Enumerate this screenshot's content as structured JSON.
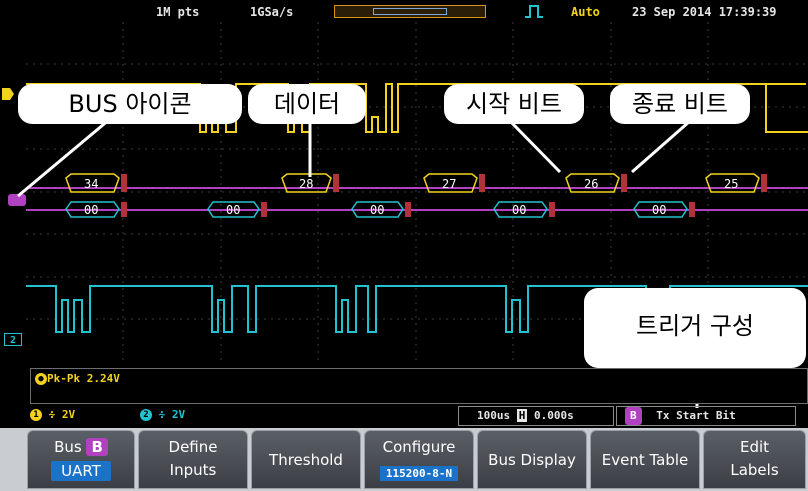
{
  "topbar": {
    "record_length": "1M pts",
    "sample_rate": "1GSa/s",
    "trigger_mode": "Auto",
    "datetime": "23 Sep 2014 17:39:39"
  },
  "callouts": {
    "bus_icon": "BUS 아이콘",
    "data": "데이터",
    "start_bit": "시작 비트",
    "stop_bit": "종료 비트",
    "trigger_config": "트리거 구성"
  },
  "decoded": {
    "top_row": [
      "34",
      "28",
      "27",
      "26",
      "25"
    ],
    "bottom_row": [
      "00",
      "00",
      "00",
      "00",
      "00"
    ]
  },
  "channel_markers": {
    "ch2": "2"
  },
  "measurement": {
    "label": "Pk-Pk 2.24V"
  },
  "status": {
    "ch1_num": "1",
    "ch1_scale": "2V",
    "ch2_num": "2",
    "ch2_scale": "2V",
    "timebase": "100us",
    "delay": "0.000s",
    "bus_badge": "B",
    "trigger_info": "Tx Start Bit"
  },
  "softkeys": {
    "bus_label": "Bus",
    "bus_badge": "B",
    "bus_value": "UART",
    "define_l1": "Define",
    "define_l2": "Inputs",
    "threshold": "Threshold",
    "configure_l1": "Configure",
    "configure_value": "115200-8-N",
    "bus_display": "Bus Display",
    "event_table": "Event Table",
    "edit_l1": "Edit",
    "edit_l2": "Labels"
  },
  "colors": {
    "ch1": "#f2d21c",
    "ch2": "#22c2d0",
    "bus": "#b042c0",
    "trigger": "#ff7a1a",
    "accent_tag": "#1b73c9"
  }
}
